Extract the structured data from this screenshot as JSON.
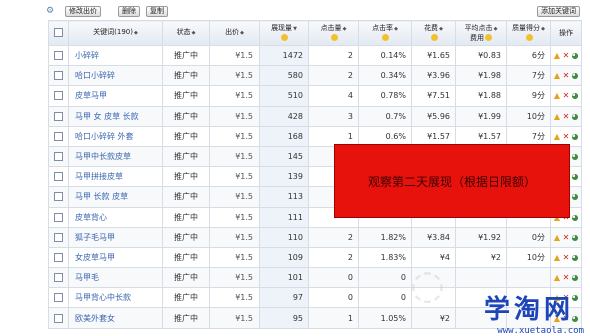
{
  "toolbar": {
    "icon": "settings-icon",
    "edit_bid_label": "修改出价",
    "delete_label": "删除",
    "copy_label": "复制",
    "add_keyword_label": "添加关键词"
  },
  "table": {
    "headers": {
      "keyword": "关键词(190)",
      "status": "状态",
      "bid": "出价",
      "impressions": "展现量",
      "clicks": "点击量",
      "ctr": "点击率",
      "cost": "花费",
      "avg_cpc_line1": "平均点击",
      "avg_cpc_line2": "费用",
      "quality": "质量得分",
      "actions": "操作"
    },
    "rows": [
      {
        "keyword": "小碎碎",
        "status": "推广中",
        "bid": "¥1.5",
        "impressions": "1472",
        "clicks": "2",
        "ctr": "0.14%",
        "cost": "¥1.65",
        "cpc": "¥0.83",
        "quality": "6分"
      },
      {
        "keyword": "哈口小碎碎",
        "status": "推广中",
        "bid": "¥1.5",
        "impressions": "580",
        "clicks": "2",
        "ctr": "0.34%",
        "cost": "¥3.96",
        "cpc": "¥1.98",
        "quality": "7分"
      },
      {
        "keyword": "皮草马甲",
        "status": "推广中",
        "bid": "¥1.5",
        "impressions": "510",
        "clicks": "4",
        "ctr": "0.78%",
        "cost": "¥7.51",
        "cpc": "¥1.88",
        "quality": "9分"
      },
      {
        "keyword": "马甲 女 皮草 长款",
        "status": "推广中",
        "bid": "¥1.5",
        "impressions": "428",
        "clicks": "3",
        "ctr": "0.7%",
        "cost": "¥5.96",
        "cpc": "¥1.99",
        "quality": "10分"
      },
      {
        "keyword": "哈口小碎碎 外套",
        "status": "推广中",
        "bid": "¥1.5",
        "impressions": "168",
        "clicks": "1",
        "ctr": "0.6%",
        "cost": "¥1.57",
        "cpc": "¥1.57",
        "quality": "7分"
      },
      {
        "keyword": "马甲中长款皮草",
        "status": "推广中",
        "bid": "¥1.5",
        "impressions": "145",
        "clicks": "",
        "ctr": "",
        "cost": "",
        "cpc": "",
        "quality": ""
      },
      {
        "keyword": "马甲拼接皮草",
        "status": "推广中",
        "bid": "¥1.5",
        "impressions": "139",
        "clicks": "",
        "ctr": "",
        "cost": "",
        "cpc": "",
        "quality": ""
      },
      {
        "keyword": "马甲 长款 皮草",
        "status": "推广中",
        "bid": "¥1.5",
        "impressions": "113",
        "clicks": "",
        "ctr": "",
        "cost": "",
        "cpc": "",
        "quality": ""
      },
      {
        "keyword": "皮草背心",
        "status": "推广中",
        "bid": "¥1.5",
        "impressions": "111",
        "clicks": "",
        "ctr": "",
        "cost": "",
        "cpc": "",
        "quality": ""
      },
      {
        "keyword": "狐子毛马甲",
        "status": "推广中",
        "bid": "¥1.5",
        "impressions": "110",
        "clicks": "2",
        "ctr": "1.82%",
        "cost": "¥3.84",
        "cpc": "¥1.92",
        "quality": "0分"
      },
      {
        "keyword": "女皮草马甲",
        "status": "推广中",
        "bid": "¥1.5",
        "impressions": "109",
        "clicks": "2",
        "ctr": "1.83%",
        "cost": "¥4",
        "cpc": "¥2",
        "quality": "10分"
      },
      {
        "keyword": "马甲毛",
        "status": "推广中",
        "bid": "¥1.5",
        "impressions": "101",
        "clicks": "0",
        "ctr": "0",
        "cost": "",
        "cpc": "",
        "quality": ""
      },
      {
        "keyword": "马甲背心中长款",
        "status": "推广中",
        "bid": "¥1.5",
        "impressions": "97",
        "clicks": "0",
        "ctr": "0",
        "cost": "",
        "cpc": "",
        "quality": ""
      },
      {
        "keyword": "欧美外套女",
        "status": "推广中",
        "bid": "¥1.5",
        "impressions": "95",
        "clicks": "1",
        "ctr": "1.05%",
        "cost": "¥2",
        "cpc": "",
        "quality": ""
      }
    ]
  },
  "overlay": {
    "text": "观察第二天展现（根据日限额）"
  },
  "watermark": {
    "brand": "学淘网",
    "url": "www.xuetaola.com"
  },
  "icons": {
    "raise": "raise-bid-icon",
    "delete": "delete-icon",
    "report": "report-pie-icon"
  },
  "colors": {
    "overlay_bg": "#e8120c",
    "keyword_link": "#3a66b2",
    "watermark": "#1d45b8"
  }
}
